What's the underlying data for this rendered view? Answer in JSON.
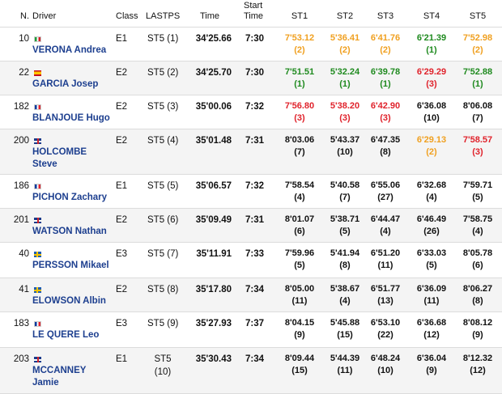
{
  "headers": {
    "n": "N.",
    "driver": "Driver",
    "class": "Class",
    "lastps": "LASTPS",
    "time": "Time",
    "start_time_1": "Start",
    "start_time_2": "Time",
    "st1": "ST1",
    "st2": "ST2",
    "st3": "ST3",
    "st4": "ST4",
    "st5": "ST5"
  },
  "colors": {
    "green": "#1f8a1f",
    "red": "#e0222b",
    "orange": "#f0a020",
    "driver": "#1d3f8f"
  },
  "rows": [
    {
      "n": "10",
      "flag": "it",
      "driver_1": "VERONA Andrea",
      "driver_2": "",
      "class": "E1",
      "lastps_1": "ST5 (1)",
      "lastps_2": "",
      "time": "34'25.66",
      "start": "7:30",
      "st": [
        {
          "t": "7'53.12",
          "p": "(2)",
          "c": "orange"
        },
        {
          "t": "5'36.41",
          "p": "(2)",
          "c": "orange"
        },
        {
          "t": "6'41.76",
          "p": "(2)",
          "c": "orange"
        },
        {
          "t": "6'21.39",
          "p": "(1)",
          "c": "green"
        },
        {
          "t": "7'52.98",
          "p": "(2)",
          "c": "orange"
        }
      ]
    },
    {
      "n": "22",
      "flag": "es",
      "driver_1": "GARCIA Josep",
      "driver_2": "",
      "class": "E2",
      "lastps_1": "ST5 (2)",
      "lastps_2": "",
      "time": "34'25.70",
      "start": "7:30",
      "st": [
        {
          "t": "7'51.51",
          "p": "(1)",
          "c": "green"
        },
        {
          "t": "5'32.24",
          "p": "(1)",
          "c": "green"
        },
        {
          "t": "6'39.78",
          "p": "(1)",
          "c": "green"
        },
        {
          "t": "6'29.29",
          "p": "(3)",
          "c": "red"
        },
        {
          "t": "7'52.88",
          "p": "(1)",
          "c": "green"
        }
      ]
    },
    {
      "n": "182",
      "flag": "fr",
      "driver_1": "BLANJOUE Hugo",
      "driver_2": "",
      "class": "E2",
      "lastps_1": "ST5 (3)",
      "lastps_2": "",
      "time": "35'00.06",
      "start": "7:32",
      "st": [
        {
          "t": "7'56.80",
          "p": "(3)",
          "c": "red"
        },
        {
          "t": "5'38.20",
          "p": "(3)",
          "c": "red"
        },
        {
          "t": "6'42.90",
          "p": "(3)",
          "c": "red"
        },
        {
          "t": "6'36.08",
          "p": "(10)",
          "c": "black"
        },
        {
          "t": "8'06.08",
          "p": "(7)",
          "c": "black"
        }
      ]
    },
    {
      "n": "200",
      "flag": "gb",
      "driver_1": "HOLCOMBE",
      "driver_2": "Steve",
      "class": "E2",
      "lastps_1": "ST5 (4)",
      "lastps_2": "",
      "time": "35'01.48",
      "start": "7:31",
      "st": [
        {
          "t": "8'03.06",
          "p": "(7)",
          "c": "black"
        },
        {
          "t": "5'43.37",
          "p": "(10)",
          "c": "black"
        },
        {
          "t": "6'47.35",
          "p": "(8)",
          "c": "black"
        },
        {
          "t": "6'29.13",
          "p": "(2)",
          "c": "orange"
        },
        {
          "t": "7'58.57",
          "p": "(3)",
          "c": "red"
        }
      ]
    },
    {
      "n": "186",
      "flag": "fr",
      "driver_1": "PICHON Zachary",
      "driver_2": "",
      "class": "E1",
      "lastps_1": "ST5 (5)",
      "lastps_2": "",
      "time": "35'06.57",
      "start": "7:32",
      "st": [
        {
          "t": "7'58.54",
          "p": "(4)",
          "c": "black"
        },
        {
          "t": "5'40.58",
          "p": "(7)",
          "c": "black"
        },
        {
          "t": "6'55.06",
          "p": "(27)",
          "c": "black"
        },
        {
          "t": "6'32.68",
          "p": "(4)",
          "c": "black"
        },
        {
          "t": "7'59.71",
          "p": "(5)",
          "c": "black"
        }
      ]
    },
    {
      "n": "201",
      "flag": "gb",
      "driver_1": "WATSON Nathan",
      "driver_2": "",
      "class": "E2",
      "lastps_1": "ST5 (6)",
      "lastps_2": "",
      "time": "35'09.49",
      "start": "7:31",
      "st": [
        {
          "t": "8'01.07",
          "p": "(6)",
          "c": "black"
        },
        {
          "t": "5'38.71",
          "p": "(5)",
          "c": "black"
        },
        {
          "t": "6'44.47",
          "p": "(4)",
          "c": "black"
        },
        {
          "t": "6'46.49",
          "p": "(26)",
          "c": "black"
        },
        {
          "t": "7'58.75",
          "p": "(4)",
          "c": "black"
        }
      ]
    },
    {
      "n": "40",
      "flag": "se",
      "driver_1": "PERSSON Mikael",
      "driver_2": "",
      "class": "E3",
      "lastps_1": "ST5 (7)",
      "lastps_2": "",
      "time": "35'11.91",
      "start": "7:33",
      "st": [
        {
          "t": "7'59.96",
          "p": "(5)",
          "c": "black"
        },
        {
          "t": "5'41.94",
          "p": "(8)",
          "c": "black"
        },
        {
          "t": "6'51.20",
          "p": "(11)",
          "c": "black"
        },
        {
          "t": "6'33.03",
          "p": "(5)",
          "c": "black"
        },
        {
          "t": "8'05.78",
          "p": "(6)",
          "c": "black"
        }
      ]
    },
    {
      "n": "41",
      "flag": "se",
      "driver_1": "ELOWSON Albin",
      "driver_2": "",
      "class": "E2",
      "lastps_1": "ST5 (8)",
      "lastps_2": "",
      "time": "35'17.80",
      "start": "7:34",
      "st": [
        {
          "t": "8'05.00",
          "p": "(11)",
          "c": "black"
        },
        {
          "t": "5'38.67",
          "p": "(4)",
          "c": "black"
        },
        {
          "t": "6'51.77",
          "p": "(13)",
          "c": "black"
        },
        {
          "t": "6'36.09",
          "p": "(11)",
          "c": "black"
        },
        {
          "t": "8'06.27",
          "p": "(8)",
          "c": "black"
        }
      ]
    },
    {
      "n": "183",
      "flag": "fr",
      "driver_1": "LE QUERE Leo",
      "driver_2": "",
      "class": "E3",
      "lastps_1": "ST5 (9)",
      "lastps_2": "",
      "time": "35'27.93",
      "start": "7:37",
      "st": [
        {
          "t": "8'04.15",
          "p": "(9)",
          "c": "black"
        },
        {
          "t": "5'45.88",
          "p": "(15)",
          "c": "black"
        },
        {
          "t": "6'53.10",
          "p": "(22)",
          "c": "black"
        },
        {
          "t": "6'36.68",
          "p": "(12)",
          "c": "black"
        },
        {
          "t": "8'08.12",
          "p": "(9)",
          "c": "black"
        }
      ]
    },
    {
      "n": "203",
      "flag": "gb",
      "driver_1": "MCCANNEY",
      "driver_2": "Jamie",
      "class": "E1",
      "lastps_1": "ST5",
      "lastps_2": "(10)",
      "time": "35'30.43",
      "start": "7:34",
      "st": [
        {
          "t": "8'09.44",
          "p": "(15)",
          "c": "black"
        },
        {
          "t": "5'44.39",
          "p": "(11)",
          "c": "black"
        },
        {
          "t": "6'48.24",
          "p": "(10)",
          "c": "black"
        },
        {
          "t": "6'36.04",
          "p": "(9)",
          "c": "black"
        },
        {
          "t": "8'12.32",
          "p": "(12)",
          "c": "black"
        }
      ]
    }
  ]
}
